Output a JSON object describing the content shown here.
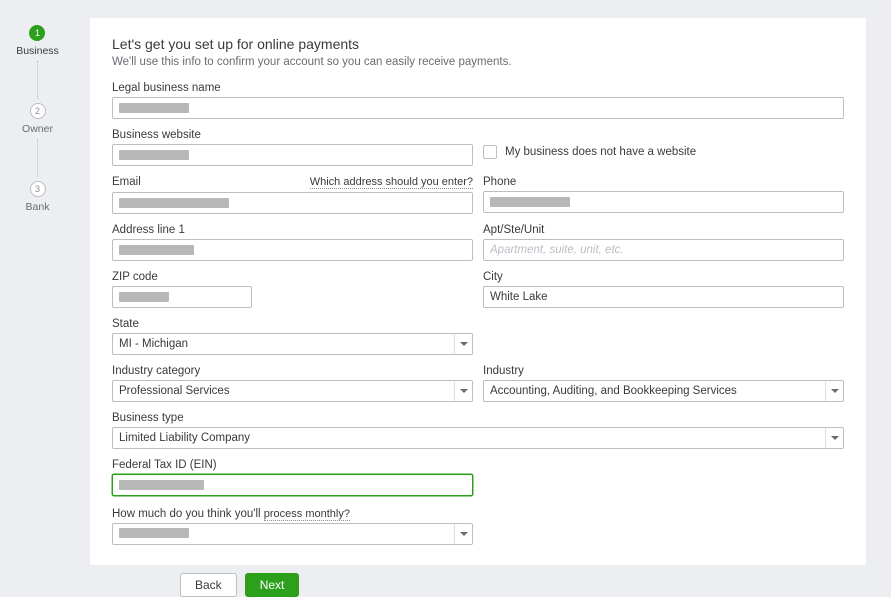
{
  "stepper": {
    "steps": [
      {
        "num": "1",
        "label": "Business",
        "active": true
      },
      {
        "num": "2",
        "label": "Owner",
        "active": false
      },
      {
        "num": "3",
        "label": "Bank",
        "active": false
      }
    ]
  },
  "header": {
    "title": "Let's get you set up for online payments",
    "subtitle": "We'll use this info to confirm your account so you can easily receive payments."
  },
  "form": {
    "legal_name": {
      "label": "Legal business name",
      "value": ""
    },
    "website": {
      "label": "Business website",
      "value": "",
      "checkbox_label": "My business does not have a website"
    },
    "email": {
      "label": "Email",
      "help": "Which address should you enter?",
      "value": ""
    },
    "phone": {
      "label": "Phone",
      "value": ""
    },
    "address1": {
      "label": "Address line 1",
      "value": ""
    },
    "apt": {
      "label": "Apt/Ste/Unit",
      "placeholder": "Apartment, suite, unit, etc.",
      "value": ""
    },
    "zip": {
      "label": "ZIP code",
      "value": ""
    },
    "city": {
      "label": "City",
      "value": "White Lake"
    },
    "state": {
      "label": "State",
      "value": "MI - Michigan"
    },
    "industry_category": {
      "label": "Industry category",
      "value": "Professional Services"
    },
    "industry": {
      "label": "Industry",
      "value": "Accounting, Auditing, and Bookkeeping Services"
    },
    "business_type": {
      "label": "Business type",
      "value": "Limited Liability Company"
    },
    "ein": {
      "label": "Federal Tax ID (EIN)",
      "value": ""
    },
    "monthly": {
      "label": "How much do you think you'll ",
      "help": "process monthly?",
      "value": ""
    }
  },
  "footer": {
    "back": "Back",
    "next": "Next"
  }
}
